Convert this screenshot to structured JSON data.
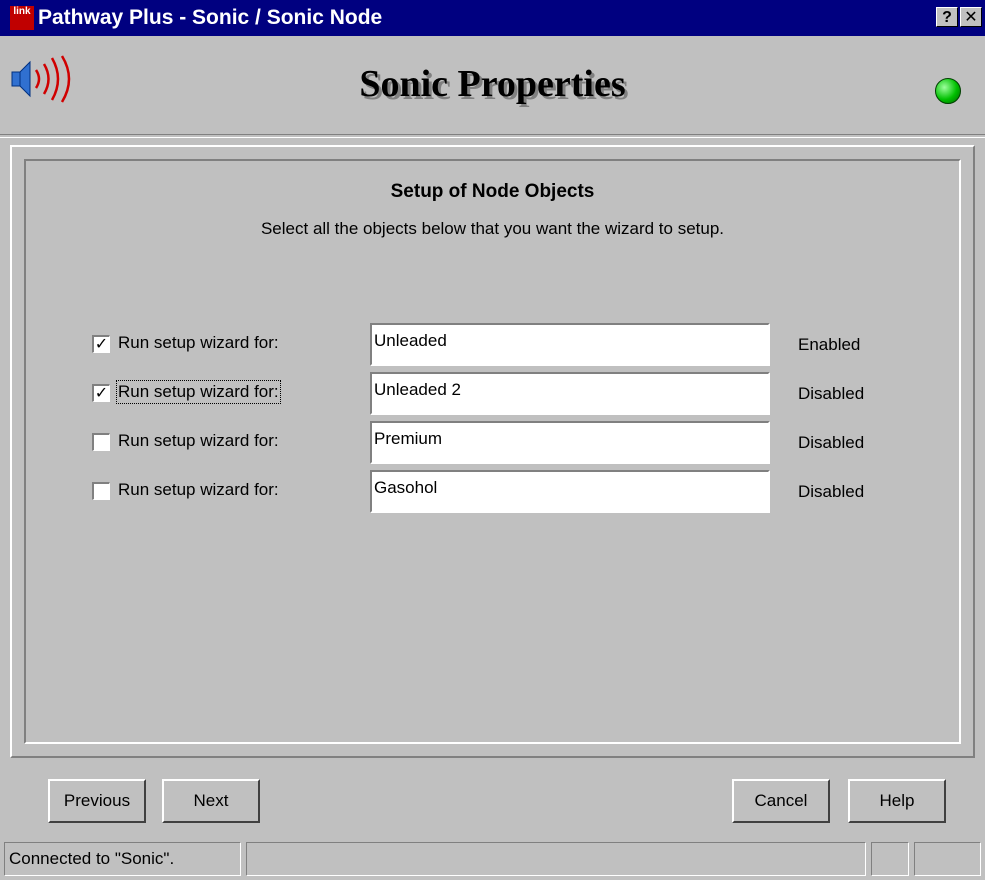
{
  "window": {
    "title": "Pathway Plus - Sonic / Sonic Node",
    "help_button": "?",
    "close_button": "✕",
    "app_icon_text": "link"
  },
  "header": {
    "title": "Sonic Properties",
    "status_color": "#00c000"
  },
  "section": {
    "title": "Setup of Node Objects",
    "description": "Select all the objects below that you want the wizard to setup."
  },
  "rows": [
    {
      "checked": true,
      "label": "Run setup wizard for:",
      "value": "Unleaded",
      "status": "Enabled"
    },
    {
      "checked": true,
      "label": "Run setup wizard for:",
      "value": "Unleaded 2",
      "status": "Disabled"
    },
    {
      "checked": false,
      "label": "Run setup wizard for:",
      "value": "Premium",
      "status": "Disabled"
    },
    {
      "checked": false,
      "label": "Run setup wizard for:",
      "value": "Gasohol",
      "status": "Disabled"
    }
  ],
  "buttons": {
    "previous": "Previous",
    "next": "Next",
    "cancel": "Cancel",
    "help": "Help"
  },
  "statusbar": {
    "connection": "Connected to \"Sonic\"."
  }
}
